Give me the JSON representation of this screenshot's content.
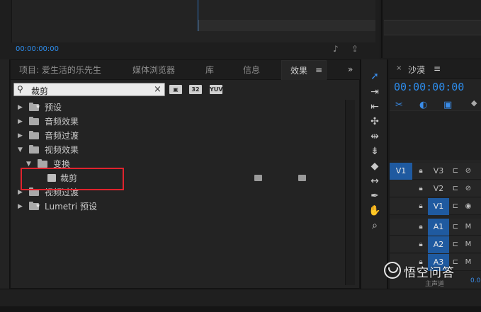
{
  "monitor": {
    "timecode": "00:00:00:00"
  },
  "effects_panel": {
    "tabs": [
      {
        "label": "项目: 爱生活的乐先生"
      },
      {
        "label": "媒体浏览器"
      },
      {
        "label": "库"
      },
      {
        "label": "信息"
      },
      {
        "label": "效果",
        "active": true
      }
    ],
    "menu_icon": "≡",
    "overflow_icon": "»",
    "search": {
      "value": "裁剪",
      "clear_icon": "×"
    },
    "filter_buttons": [
      "▣",
      "32",
      "YUV"
    ],
    "tree": [
      {
        "label": "预设",
        "expanded": false
      },
      {
        "label": "音频效果",
        "expanded": false
      },
      {
        "label": "音频过渡",
        "expanded": false
      },
      {
        "label": "视频效果",
        "expanded": true
      },
      {
        "label": "变换",
        "expanded": true
      },
      {
        "label": "裁剪",
        "selected": true
      },
      {
        "label": "视频过渡",
        "expanded": false
      },
      {
        "label": "Lumetri 预设",
        "expanded": false
      }
    ]
  },
  "tools": [
    "selection-tool",
    "track-select-tool",
    "ripple-edit-tool",
    "rolling-edit-tool",
    "rate-stretch-tool",
    "razor-tool",
    "slip-tool",
    "slide-tool",
    "pen-tool",
    "hand-tool",
    "zoom-tool"
  ],
  "timeline": {
    "close_icon": "×",
    "title": "沙漠",
    "menu_icon": "≡",
    "timecode": "00:00:00:00",
    "tracks": [
      {
        "source": "V1",
        "name": "V3",
        "targeted": false
      },
      {
        "source": "",
        "name": "V2",
        "targeted": false
      },
      {
        "source": "",
        "name": "V1",
        "targeted": true
      },
      {
        "source": "",
        "name": "A1",
        "targeted": true
      },
      {
        "source": "",
        "name": "A2",
        "targeted": true
      },
      {
        "source": "",
        "name": "A3",
        "targeted": true
      }
    ],
    "footer_label": "主声道",
    "footer_value": "0.0"
  },
  "watermark": {
    "text": "悟空问答"
  },
  "colors": {
    "accent": "#2d8ceb",
    "highlight_box": "#e0232d",
    "track_target": "#1f5aa0"
  }
}
